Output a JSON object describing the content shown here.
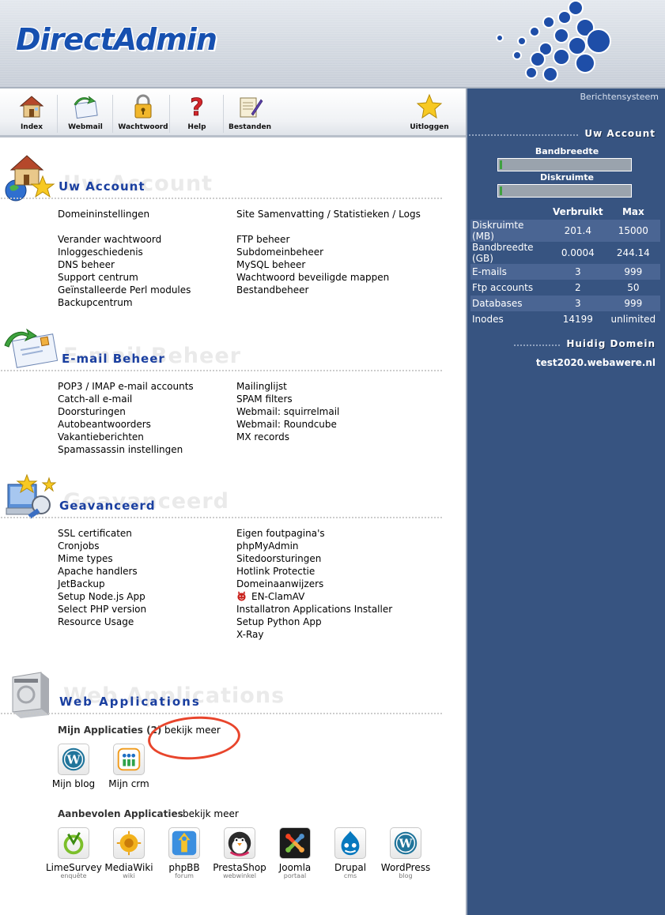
{
  "header": {
    "logo_text": "DirectAdmin"
  },
  "toolbar": {
    "items": [
      {
        "label": "Index",
        "icon": "house-icon"
      },
      {
        "label": "Webmail",
        "icon": "mail-arrow-icon"
      },
      {
        "label": "Wachtwoord",
        "icon": "padlock-icon"
      },
      {
        "label": "Help",
        "icon": "question-mark-icon"
      },
      {
        "label": "Bestanden",
        "icon": "file-manager-icon"
      },
      {
        "label": "Uitloggen",
        "icon": "star-icon"
      }
    ]
  },
  "sidebar": {
    "top_link": "Berichtensysteem",
    "account_heading": "Uw Account",
    "bandwidth_label": "Bandbreedte",
    "bandwidth_fill": 0.01,
    "disk_label": "Diskruimte",
    "disk_fill": 0.02,
    "stats_headers": [
      "Verbruikt",
      "Max"
    ],
    "stats": [
      {
        "label": "Diskruimte (MB)",
        "used": "201.4",
        "max": "15000"
      },
      {
        "label": "Bandbreedte (GB)",
        "used": "0.0004",
        "max": "244.14"
      },
      {
        "label": "E-mails",
        "used": "3",
        "max": "999"
      },
      {
        "label": "Ftp accounts",
        "used": "2",
        "max": "50"
      },
      {
        "label": "Databases",
        "used": "3",
        "max": "999"
      },
      {
        "label": "Inodes",
        "used": "14199",
        "max": "unlimited"
      }
    ],
    "domain_heading": "Huidig Domein",
    "domain": "test2020.webawere.nl"
  },
  "sections": {
    "account": {
      "title": "Uw Account",
      "watermark": "Uw Account",
      "left": [
        "Domeininstellingen",
        "",
        "Verander wachtwoord",
        "Inloggeschiedenis",
        "DNS beheer",
        "Support centrum",
        "Geïnstalleerde Perl modules",
        "Backupcentrum"
      ],
      "right": [
        "Site Samenvatting / Statistieken / Logs",
        "",
        "FTP beheer",
        "Subdomeinbeheer",
        "MySQL beheer",
        "Wachtwoord beveiligde mappen",
        "Bestandbeheer"
      ]
    },
    "email": {
      "title": "E-mail Beheer",
      "watermark": "E-mail Beheer",
      "left": [
        "POP3 / IMAP e-mail accounts",
        "Catch-all e-mail",
        "Doorsturingen",
        "Autobeantwoorders",
        "Vakantieberichten",
        "Spamassassin instellingen"
      ],
      "right": [
        "Mailinglijst",
        "SPAM filters",
        "Webmail: squirrelmail",
        "Webmail: Roundcube",
        "MX records"
      ]
    },
    "advanced": {
      "title": "Geavanceerd",
      "watermark": "Geavanceerd",
      "left": [
        "SSL certificaten",
        "Cronjobs",
        "Mime types",
        "Apache handlers",
        "JetBackup",
        "Setup Node.js App",
        "Select PHP version",
        "Resource Usage"
      ],
      "right": [
        "Eigen foutpagina's",
        "phpMyAdmin",
        "Sitedoorsturingen",
        "Hotlink Protectie",
        "Domeinaanwijzers",
        "EN-ClamAV",
        "Installatron Applications Installer",
        "Setup Python App",
        "X-Ray"
      ]
    },
    "webapps": {
      "title": "Web Applications",
      "watermark": "Web Applications",
      "my_apps_label": "Mijn Applicaties (2)",
      "my_apps_more": "bekijk meer",
      "my_apps": [
        {
          "name": "Mijn blog",
          "icon": "wordpress-icon"
        },
        {
          "name": "Mijn crm",
          "icon": "crm-grid-icon"
        }
      ],
      "recommended_label": "Aanbevolen Applicaties",
      "recommended_more": "bekijk meer",
      "recommended": [
        {
          "name": "LimeSurvey",
          "sub": "enquête",
          "icon": "limesurvey-icon"
        },
        {
          "name": "MediaWiki",
          "sub": "wiki",
          "icon": "mediawiki-icon"
        },
        {
          "name": "phpBB",
          "sub": "forum",
          "icon": "phpbb-icon"
        },
        {
          "name": "PrestaShop",
          "sub": "webwinkel",
          "icon": "prestashop-icon"
        },
        {
          "name": "Joomla",
          "sub": "portaal",
          "icon": "joomla-icon"
        },
        {
          "name": "Drupal",
          "sub": "cms",
          "icon": "drupal-icon"
        },
        {
          "name": "WordPress",
          "sub": "blog",
          "icon": "wordpress-icon"
        }
      ]
    }
  },
  "colors": {
    "sidebar_bg": "#375481",
    "title_blue": "#1a3fa0",
    "annotation_red": "#e8452c"
  }
}
